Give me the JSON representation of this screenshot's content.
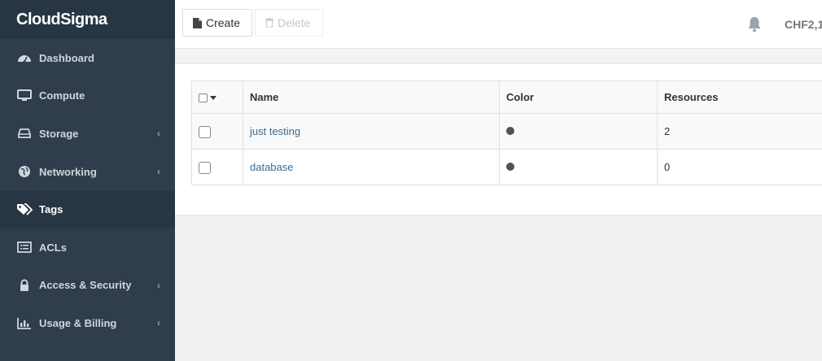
{
  "brand": {
    "name": "CloudSigma"
  },
  "sidebar": {
    "items": [
      {
        "label": "Dashboard",
        "icon": "dashboard-icon",
        "chevron": false,
        "active": false
      },
      {
        "label": "Compute",
        "icon": "monitor-icon",
        "chevron": false,
        "active": false
      },
      {
        "label": "Storage",
        "icon": "hard-drive-icon",
        "chevron": true,
        "active": false
      },
      {
        "label": "Networking",
        "icon": "globe-icon",
        "chevron": true,
        "active": false
      },
      {
        "label": "Tags",
        "icon": "tags-icon",
        "chevron": false,
        "active": true
      },
      {
        "label": "ACLs",
        "icon": "list-alt-icon",
        "chevron": false,
        "active": false
      },
      {
        "label": "Access & Security",
        "icon": "lock-icon",
        "chevron": true,
        "active": false
      },
      {
        "label": "Usage & Billing",
        "icon": "bar-chart-icon",
        "chevron": true,
        "active": false
      }
    ]
  },
  "toolbar": {
    "create_label": "Create",
    "delete_label": "Delete"
  },
  "header": {
    "balance": "CHF2,1"
  },
  "table": {
    "columns": [
      "Name",
      "Color",
      "Resources"
    ],
    "rows": [
      {
        "name": "just testing",
        "color": "#584d5e",
        "resources": "2"
      },
      {
        "name": "database",
        "color": "#584d5e",
        "resources": "0"
      }
    ]
  },
  "colors": {
    "sidebar_bg": "#2f3d4c",
    "sidebar_active_bg": "#283644",
    "link": "#3d6c8f"
  }
}
